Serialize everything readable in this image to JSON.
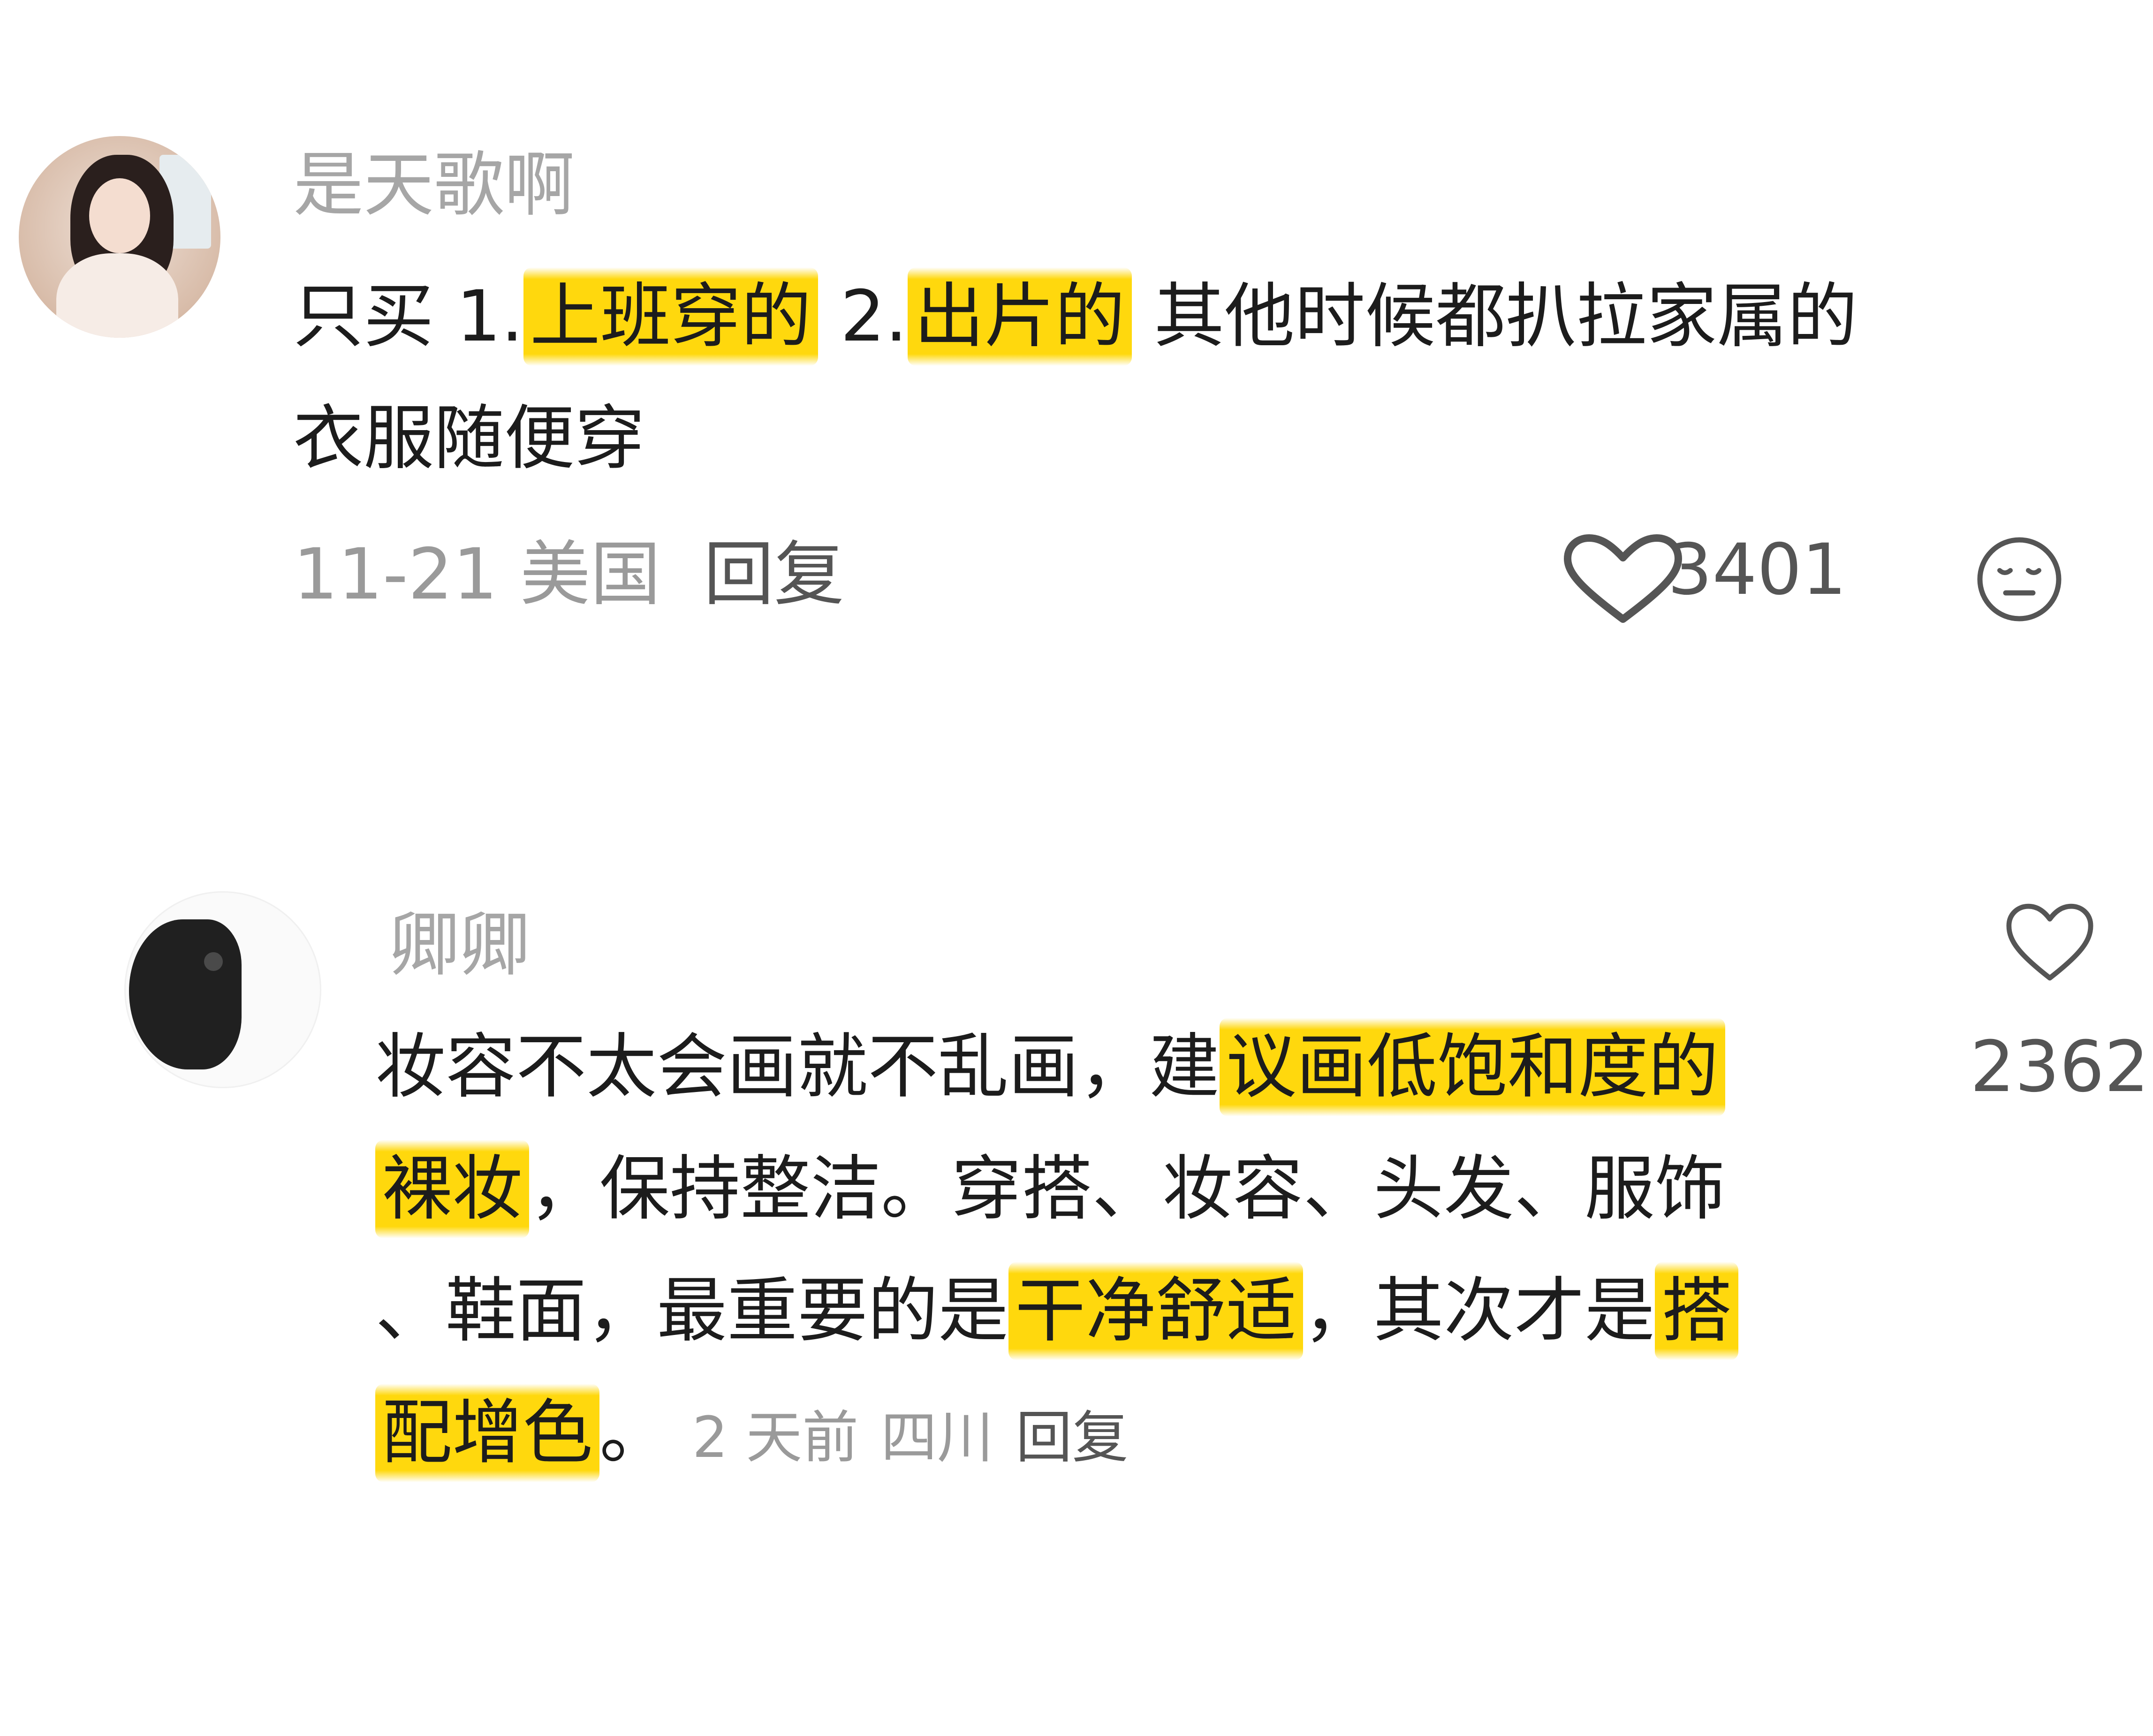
{
  "comments": [
    {
      "username": "是天歌啊",
      "lines": [
        [
          "只买 1.",
          {
            "hl": "上班穿的"
          },
          " 2.",
          {
            "hl": "出片的"
          },
          " 其他时候都扒拉家属的"
        ],
        [
          "衣服随便穿"
        ]
      ],
      "line1_a": "只买 1.",
      "line1_hl1": "上班穿的",
      "line1_b": " 2.",
      "line1_hl2": "出片的",
      "line1_c": " 其他时候都扒拉家属的",
      "line2": "衣服随便穿",
      "date": "11-21",
      "location": "美国",
      "reply": "回复",
      "likes": "3401",
      "like_icon": "heart-outline-icon",
      "dislike_icon": "neutral-face-icon"
    },
    {
      "username": "卿卿",
      "line1_a": "妆容不太会画就不乱画，建",
      "line1_hl": "议画低饱和度的",
      "line2_hl": "裸妆",
      "line2_b": "，保持整洁。穿搭、妆容、头发、服饰",
      "line3_a": "、鞋面，最重要的是",
      "line3_hl": "干净舒适",
      "line3_b": "，其次才是",
      "line3_hl2": "搭",
      "line4_hl": "配增色",
      "line4_b": "。",
      "time": "2 天前",
      "location": "四川",
      "reply": "回复",
      "likes": "2362",
      "like_icon": "heart-outline-icon"
    }
  ],
  "colors": {
    "highlight": "#ffd600",
    "username": "#a6a6a6",
    "body_text": "#1c1c1c",
    "meta_text": "#9a9a9a"
  }
}
